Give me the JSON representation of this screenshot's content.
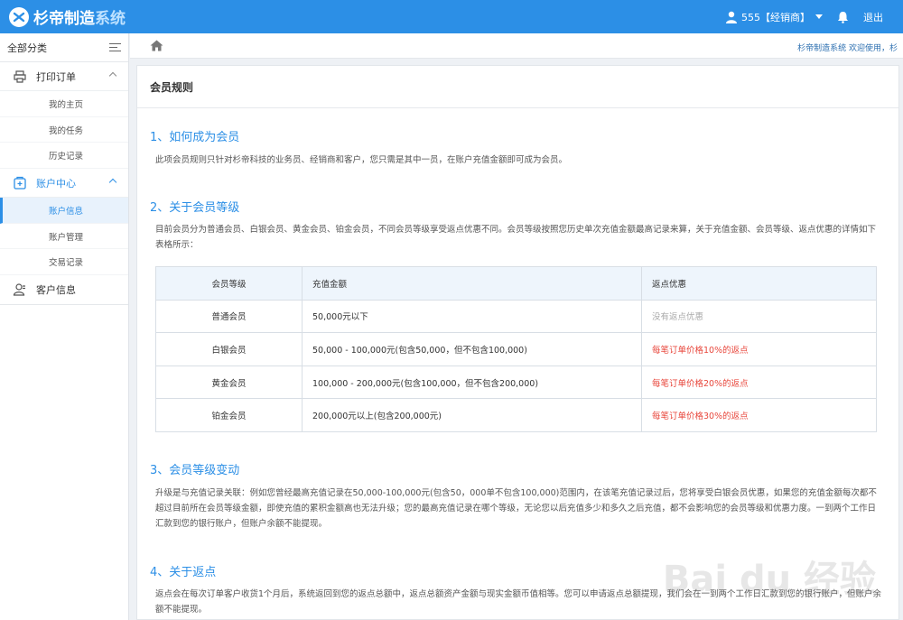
{
  "header": {
    "brand_part1": "杉帝制造",
    "brand_part2": "系统",
    "user_label": "555【经销商】",
    "logout_label": "退出"
  },
  "sidebar": {
    "title": "全部分类",
    "groups": [
      {
        "label": "打印订单",
        "icon": "printer-icon",
        "items": [
          "我的主页",
          "我的任务",
          "历史记录"
        ]
      },
      {
        "label": "账户中心",
        "icon": "wallet-icon",
        "items": [
          "账户信息",
          "账户管理",
          "交易记录"
        ],
        "selected": "账户信息"
      },
      {
        "label": "客户信息",
        "icon": "customer-icon",
        "items": []
      }
    ]
  },
  "breadcrumb": {
    "right_text": "杉帝制造系统  欢迎使用，杉"
  },
  "content": {
    "title": "会员规则",
    "sections": [
      {
        "title": "1、如何成为会员",
        "text": "此项会员规则只针对杉帝科技的业务员、经销商和客户，您只需是其中一员，在账户充值金额即可成为会员。"
      },
      {
        "title": "2、关于会员等级",
        "text": "目前会员分为普通会员、白银会员、黄金会员、铂金会员，不同会员等级享受返点优惠不同。会员等级按照您历史单次充值金额最高记录来算，关于充值金额、会员等级、返点优惠的详情如下表格所示："
      },
      {
        "title": "3、会员等级变动",
        "text": "升级是与充值记录关联：例如您曾经最高充值记录在50,000-100,000元(包含50，000单不包含100,000)范围内，在该笔充值记录过后，您将享受白银会员优惠，如果您的充值金额每次都不超过目前所在会员等级金额，即使充值的累积金额高也无法升级；您的最高充值记录在哪个等级，无论您以后充值多少和多久之后充值，都不会影响您的会员等级和优惠力度。一到两个工作日汇款到您的银行账户，但账户余额不能提现。"
      },
      {
        "title": "4、关于返点",
        "text": "返点会在每次订单客户收货1个月后，系统返回到您的返点总额中，返点总额资产金额与现实金额币值相等。您可以申请返点总额提现，我们会在一到两个工作日汇款到您的银行账户，但账户余额不能提现。"
      }
    ],
    "table": {
      "headers": [
        "会员等级",
        "充值金额",
        "返点优惠"
      ],
      "rows": [
        [
          "普通会员",
          "50,000元以下",
          "没有返点优惠"
        ],
        [
          "白银会员",
          "50,000 - 100,000元(包含50,000，但不包含100,000)",
          "每笔订单价格10%的返点"
        ],
        [
          "黄金会员",
          "100,000 - 200,000元(包含100,000，但不包含200,000)",
          "每笔订单价格20%的返点"
        ],
        [
          "铂金会员",
          "200,000元以上(包含200,000元)",
          "每笔订单价格30%的返点"
        ]
      ]
    }
  },
  "watermark": "Bai du 经验",
  "colors": {
    "primary": "#2c8fe6",
    "discount_red": "#e8473c"
  }
}
